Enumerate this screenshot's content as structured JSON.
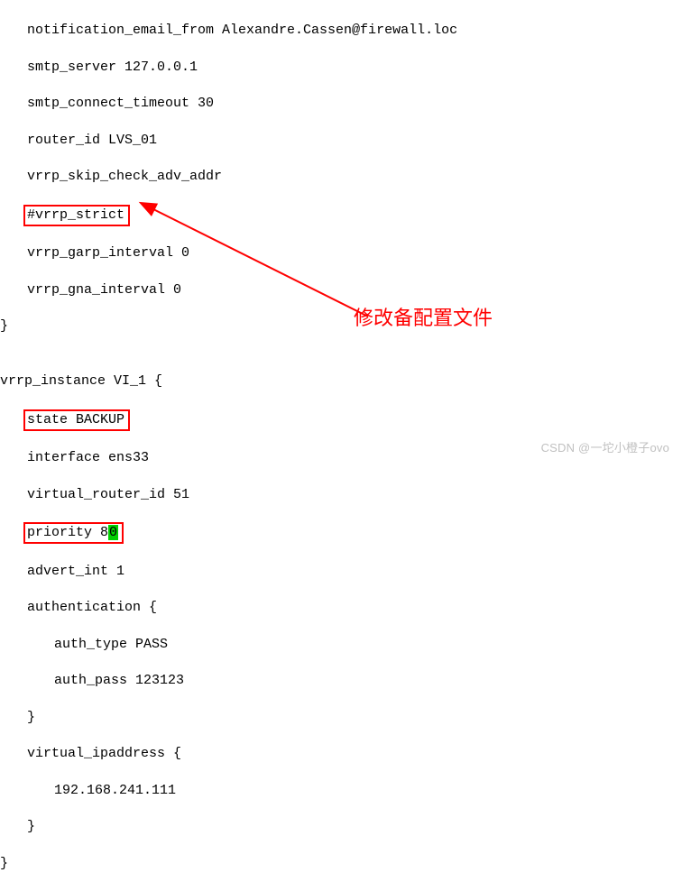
{
  "code": {
    "l1": "notification_email_from Alexandre.Cassen@firewall.loc",
    "l2": "smtp_server 127.0.0.1",
    "l3": "smtp_connect_timeout 30",
    "l4": "router_id LVS_01",
    "l5": "vrrp_skip_check_adv_addr",
    "l6": "#vrrp_strict",
    "l7": "vrrp_garp_interval 0",
    "l8": "vrrp_gna_interval 0",
    "l9": "}",
    "l10": "",
    "l11": "vrrp_instance VI_1 {",
    "l12": "state BACKUP",
    "l13": "interface ens33",
    "l14": "virtual_router_id 51",
    "l15a": "priority 8",
    "l15b": "0",
    "l16": "advert_int 1",
    "l17": "authentication {",
    "l18": "auth_type PASS",
    "l19": "auth_pass 123123",
    "l20": "}",
    "l21": "virtual_ipaddress {",
    "l22": "192.168.241.111",
    "l23": "}",
    "l24": "}"
  },
  "annotation": "修改备配置文件",
  "watermark": "CSDN @一坨小橙子ovo",
  "highlights": {
    "box1": "#vrrp_strict",
    "box2": "state BACKUP",
    "box3": "priority 80"
  }
}
